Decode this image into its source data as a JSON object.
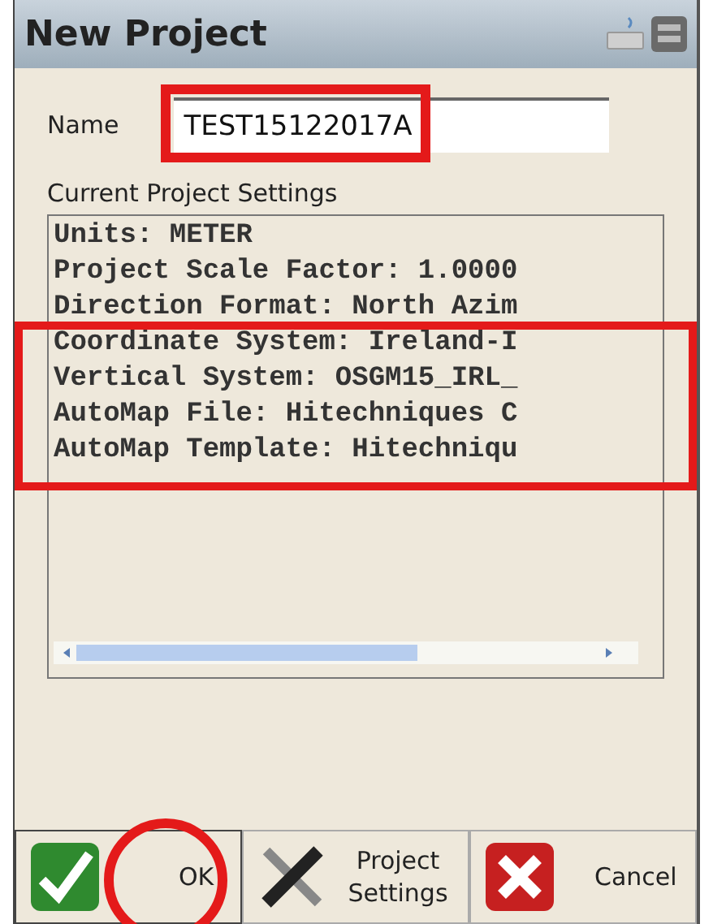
{
  "window": {
    "title": "New Project"
  },
  "name_field": {
    "label": "Name",
    "value": "TEST15122017A"
  },
  "settings": {
    "label": "Current Project Settings",
    "lines": [
      "Units: METER",
      "Project Scale Factor: 1.0000",
      "Direction Format: North Azim",
      "Coordinate System: Ireland-I",
      "Vertical System: OSGM15_IRL_",
      "AutoMap File: Hitechniques C",
      "AutoMap Template: Hitechniqu"
    ]
  },
  "buttons": [
    {
      "kind": "ok",
      "label": "OK"
    },
    {
      "kind": "tools",
      "label": "Project Settings"
    },
    {
      "kind": "cancel",
      "label": "Cancel"
    }
  ]
}
